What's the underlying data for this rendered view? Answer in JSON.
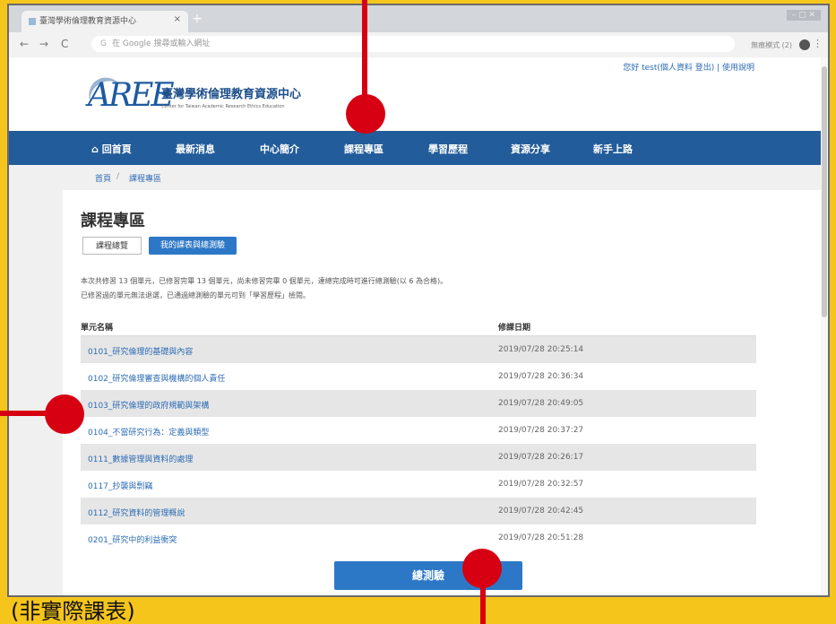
{
  "browser": {
    "tab_title": "臺灣學術倫理教育資源中心",
    "new_tab": "+",
    "window_controls": "– ▢ ✕",
    "back": "←",
    "forward": "→",
    "reload": "C",
    "url_placeholder": "在 Google 搜尋或輸入網址",
    "bookmarks_label": "無痕模式 (2)",
    "menu": "⋮"
  },
  "site": {
    "user_bar": "您好 test(個人資料 登出) | 使用說明",
    "logo_mark": "AREE",
    "logo_title": "臺灣學術倫理教育資源中心",
    "logo_subtitle": "Center for Taiwan Academic Research Ethics Education",
    "nav": [
      "回首頁",
      "最新消息",
      "中心簡介",
      "課程專區",
      "學習歷程",
      "資源分享",
      "新手上路"
    ],
    "breadcrumb": [
      "首頁",
      "課程專區"
    ],
    "page_title": "課程專區",
    "tab_overview": "課程總覽",
    "tab_mycourse": "我的課表與總測驗",
    "note_line1": "本次共修習 13 個單元，已修習完畢 13 個單元，尚未修習完畢 0 個單元，達總完成時可進行總測驗(以 6 為合格)。",
    "note_line2": "已修習過的單元無法退選，已通過總測驗的單元可到「學習歷程」檢閱。",
    "table": {
      "col_unit": "單元名稱",
      "col_date": "修課日期",
      "rows": [
        {
          "unit": "0101_研究倫理的基礎與內容",
          "date": "2019/07/28 20:25:14"
        },
        {
          "unit": "0102_研究倫理審查與機構的個人責任",
          "date": "2019/07/28 20:36:34"
        },
        {
          "unit": "0103_研究倫理的政府規範與架構",
          "date": "2019/07/28 20:49:05"
        },
        {
          "unit": "0104_不當研究行為：定義與類型",
          "date": "2019/07/28 20:37:27"
        },
        {
          "unit": "0111_數據管理與資料的處理",
          "date": "2019/07/28 20:26:17"
        },
        {
          "unit": "0117_抄襲與剽竊",
          "date": "2019/07/28 20:32:57"
        },
        {
          "unit": "0112_研究資料的管理概說",
          "date": "2019/07/28 20:42:45"
        },
        {
          "unit": "0201_研究中的利益衝突",
          "date": "2019/07/28 20:51:28"
        }
      ]
    },
    "test_button": "總測驗"
  },
  "caption": "(非實際課表)",
  "colors": {
    "nav_blue": "#235c9a",
    "button_blue": "#2d78c6",
    "marker_red": "#d60012",
    "frame_yellow": "#f5c51c"
  }
}
